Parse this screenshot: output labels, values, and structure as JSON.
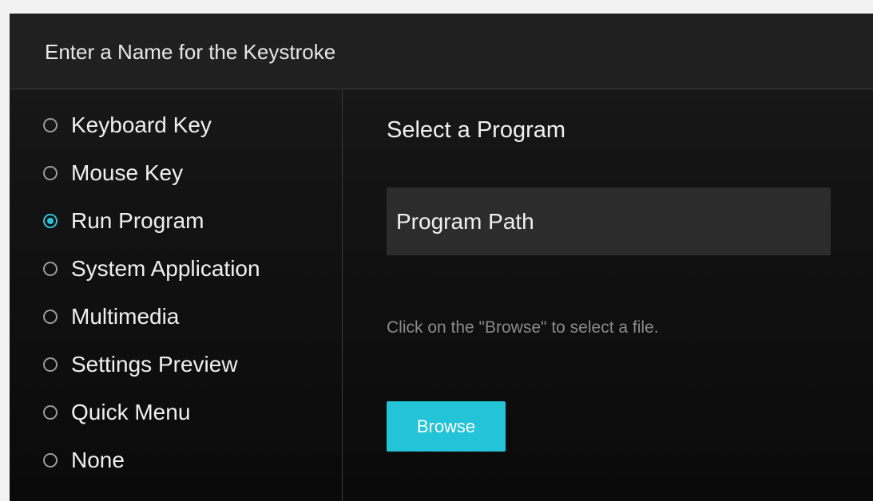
{
  "header": {
    "title": "Enter a Name for the Keystroke"
  },
  "options": {
    "selected": "Run Program",
    "items": [
      {
        "label": "Keyboard Key",
        "checked": false
      },
      {
        "label": "Mouse Key",
        "checked": false
      },
      {
        "label": "Run Program",
        "checked": true
      },
      {
        "label": "System Application",
        "checked": false
      },
      {
        "label": "Multimedia",
        "checked": false
      },
      {
        "label": "Settings Preview",
        "checked": false
      },
      {
        "label": "Quick Menu",
        "checked": false
      },
      {
        "label": "None",
        "checked": false
      }
    ]
  },
  "program": {
    "title": "Select a Program",
    "path_placeholder": "Program Path",
    "path_value": "",
    "hint": "Click on the \"Browse\" to select a file.",
    "browse_label": "Browse"
  },
  "colors": {
    "accent": "#23c3d8",
    "background": "#141414",
    "header_background": "#202020",
    "input_background": "#2c2c2c",
    "hint_text": "#8a8a8a"
  }
}
